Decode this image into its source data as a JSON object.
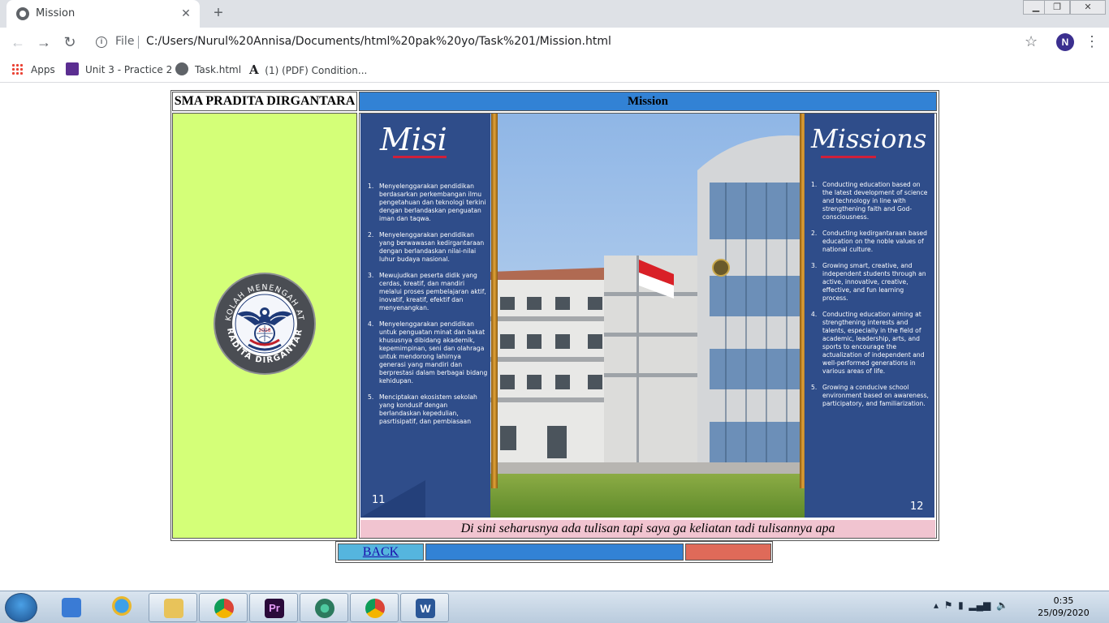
{
  "browser": {
    "tab_title": "Mission",
    "tab_close": "✕",
    "new_tab": "+",
    "scheme": "File",
    "url": "C:/Users/Nurul%20Annisa/Documents/html%20pak%20yo/Task%201/Mission.html",
    "avatar_initial": "N",
    "bookmarks": [
      "Apps",
      "Unit 3 - Practice 2",
      "Task.html",
      "(1) (PDF) Condition..."
    ]
  },
  "page": {
    "school_name": "SMA PRADITA DIRGANTARA",
    "mission_heading": "Mission",
    "caption": "Di sini seharusnya ada tulisan tapi saya ga keliatan tadi tulisannya apa",
    "back_label": "BACK",
    "colors": {
      "left_panel": "#d4ff78",
      "header_blue": "#3282d5",
      "caption_pink": "#f1c4d0",
      "back_cyan": "#55b5de",
      "nav_red": "#df6a59"
    },
    "logo": {
      "top_text": "SEKOLAH MENENGAH ATAS",
      "bottom_text": "PRADITA DIRGANTARA",
      "year": "2018"
    }
  },
  "poster": {
    "left_title": "Misi",
    "right_title": "Missions",
    "left_page": "11",
    "right_page": "12",
    "left_items": [
      "Menyelenggarakan pendidikan berdasarkan perkembangan ilmu pengetahuan dan teknologi terkini dengan berlandaskan penguatan iman dan taqwa.",
      "Menyelenggarakan pendidikan yang berwawasan kedirgantaraan dengan berlandaskan nilai-nilai luhur budaya nasional.",
      "Mewujudkan peserta didik yang cerdas, kreatif, dan mandiri melalui proses pembelajaran aktif, inovatif, kreatif, efektif dan menyenangkan.",
      "Menyelenggarakan pendidikan untuk penguatan minat dan bakat khususnya dibidang akademik, kepemimpinan, seni dan olahraga untuk mendorong lahirnya generasi yang mandiri dan berprestasi dalam berbagai bidang kehidupan.",
      "Menciptakan ekosistem sekolah yang kondusif dengan berlandaskan kepedulian, pasrtisipatif, dan pembiasaan"
    ],
    "right_items": [
      "Conducting education based on the latest development of science and technology in line with strengthening faith and God-consciousness.",
      "Conducting kedirgantaraan based education on the noble values of national culture.",
      "Growing smart, creative, and independent students through an active, innovative, creative, effective, and fun learning process.",
      "Conducting education aiming at strengthening interests and talents, especially in the field of academic, leadership, arts, and sports to encourage the actualization of independent and well-performed generations in various areas of life.",
      "Growing a conducive school environment based on awareness, participatory, and familiarization."
    ]
  },
  "taskbar": {
    "time": "0:35",
    "date": "25/09/2020"
  }
}
